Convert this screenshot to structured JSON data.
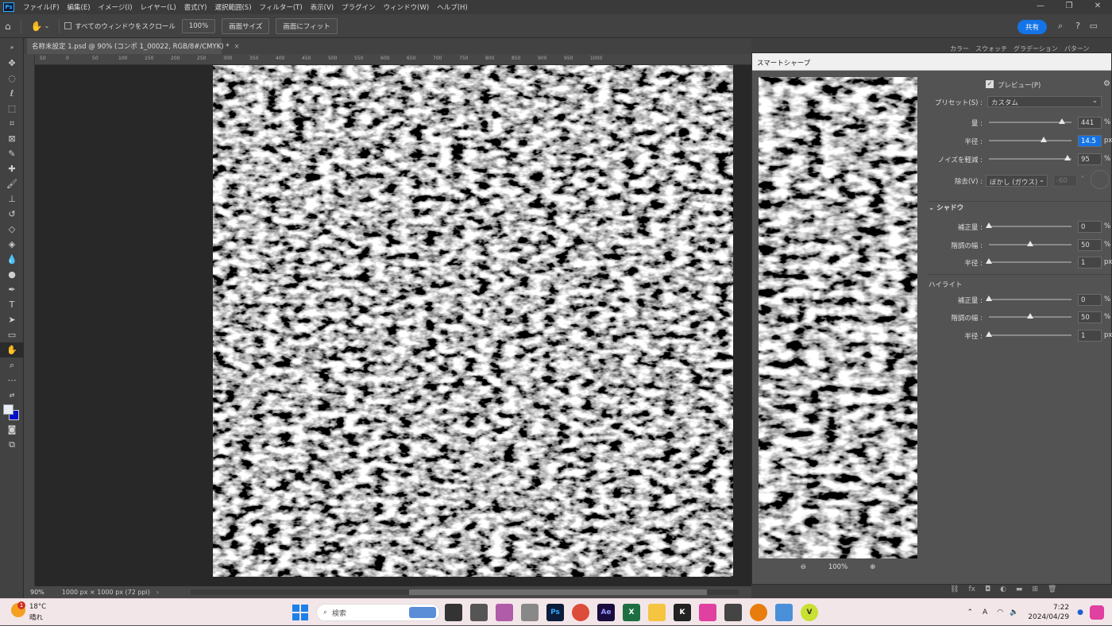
{
  "menu": {
    "items": [
      "ファイル(F)",
      "編集(E)",
      "イメージ(I)",
      "レイヤー(L)",
      "書式(Y)",
      "選択範囲(S)",
      "フィルター(T)",
      "表示(V)",
      "プラグイン",
      "ウィンドウ(W)",
      "ヘルプ(H)"
    ]
  },
  "options": {
    "scroll_all_label": "すべてのウィンドウをスクロール",
    "zoom_label": "100%",
    "screen_size_label": "画面サイズ",
    "fit_screen_label": "画面にフィット",
    "share_label": "共有"
  },
  "document": {
    "tab_title": "名称未設定 1.psd @ 90% (コンポ 1_00022, RGB/8#/CMYK) *"
  },
  "ruler": {
    "labels": [
      "50",
      "0",
      "50",
      "100",
      "150",
      "200",
      "250",
      "300",
      "350",
      "400",
      "450",
      "500",
      "550",
      "600",
      "650",
      "700",
      "750",
      "800",
      "850",
      "900",
      "950",
      "1000"
    ]
  },
  "status": {
    "zoom": "90%",
    "doc_size": "1000 px × 1000 px (72 ppi)"
  },
  "panel_tabs": [
    "カラー",
    "スウォッチ",
    "グラデーション",
    "パターン"
  ],
  "dialog": {
    "title": "スマートシャープ",
    "preview_label": "プレビュー(P)",
    "preset_label": "プリセット(S) :",
    "preset_value": "カスタム",
    "amount": {
      "label": "量 :",
      "value": "441",
      "unit": "%",
      "level": 0.88
    },
    "radius": {
      "label": "半径 :",
      "value": "14.5",
      "unit": "px",
      "level": 0.66
    },
    "noise": {
      "label": "ノイズを軽減 :",
      "value": "95",
      "unit": "%",
      "level": 0.95
    },
    "remove_label": "除去(V) :",
    "remove_value": "ぼかし (ガウス)",
    "angle_value": "-60",
    "angle_unit": "°",
    "shadow": {
      "title": "シャドウ",
      "amount": {
        "label": "補正量 :",
        "value": "0",
        "unit": "%",
        "level": 0
      },
      "tonal": {
        "label": "階調の幅 :",
        "value": "50",
        "unit": "%",
        "level": 0.5
      },
      "radius": {
        "label": "半径 :",
        "value": "1",
        "unit": "px",
        "level": 0
      }
    },
    "highlight": {
      "title": "ハイライト",
      "amount": {
        "label": "補正量 :",
        "value": "0",
        "unit": "%",
        "level": 0
      },
      "tonal": {
        "label": "階調の幅 :",
        "value": "50",
        "unit": "%",
        "level": 0.5
      },
      "radius": {
        "label": "半径 :",
        "value": "1",
        "unit": "px",
        "level": 0
      }
    },
    "zoom_value": "100%"
  },
  "taskbar": {
    "weather_temp": "18°C",
    "weather_text": "晴れ",
    "weather_badge": "1",
    "search_placeholder": "検索",
    "time": "7:22",
    "date": "2024/04/29",
    "ime": "A"
  }
}
